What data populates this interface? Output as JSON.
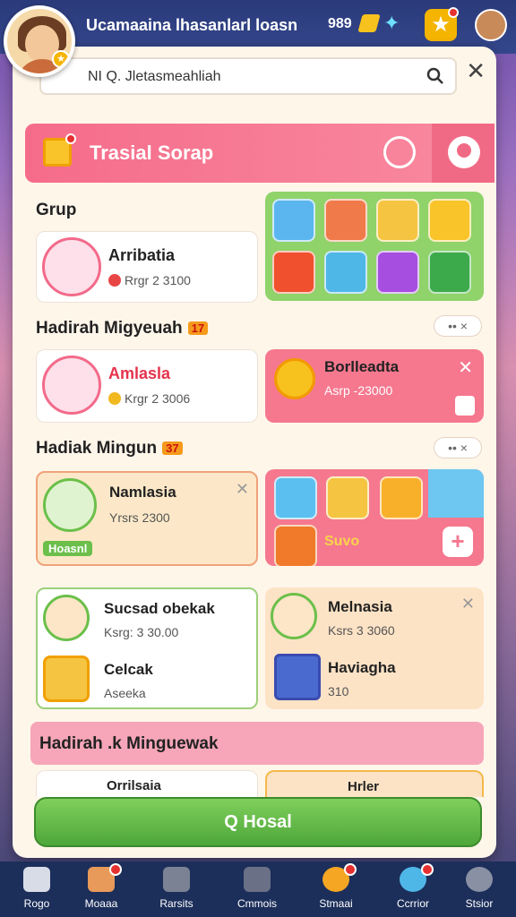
{
  "topbar": {
    "title": "Ucamaaina lhasanlarl loasn",
    "coins": "989"
  },
  "search": {
    "value": "NI Q. Jletasmeahliah"
  },
  "header": {
    "title": "Trasial Sorap"
  },
  "sections": {
    "grup": "Grup",
    "mingguan1": "Hadirah Migyeuah",
    "mingguan1_tag": "17",
    "mingguan2": "Hadiak Mingun",
    "mingguan2_tag": "37",
    "banner": "Hadirah .k Minguewak",
    "more": "•• ×"
  },
  "cards": {
    "c1": {
      "name": "Arribatia",
      "meta": "Rrgr 2 3100"
    },
    "c2": {
      "name": "Amlasla",
      "meta": "Krgr 2 3006"
    },
    "c3": {
      "name": "Borlleadta",
      "meta": "Asrp -23000"
    },
    "c4": {
      "name": "Namlasia",
      "meta": "Yrsrs 2300",
      "pill": "Hoasnl"
    },
    "c5_label": "Suvo",
    "c6a": {
      "name": "Sucsad obekak",
      "meta": "Ksrg: 3 30.00"
    },
    "c6b": {
      "name": "Celcak",
      "meta": "Aseeka"
    },
    "c7a": {
      "name": "Melnasia",
      "meta": "Ksrs 3 3060"
    },
    "c7b": {
      "name": "Haviagha",
      "meta": "310"
    },
    "peek1": "Orrilsaia",
    "peek2": "Hrler"
  },
  "cta": {
    "label": "Q Hosal"
  },
  "nav": [
    {
      "label": "Rogo"
    },
    {
      "label": "Moaaa"
    },
    {
      "label": "Rarsits"
    },
    {
      "label": "Cmmois"
    },
    {
      "label": "Stmaai"
    },
    {
      "label": "Ccrrior"
    },
    {
      "label": "Stsior"
    }
  ],
  "colors": {
    "accent_pink": "#f56c8a",
    "accent_green": "#4ea73a",
    "nav_bg": "#1c2e5a"
  }
}
